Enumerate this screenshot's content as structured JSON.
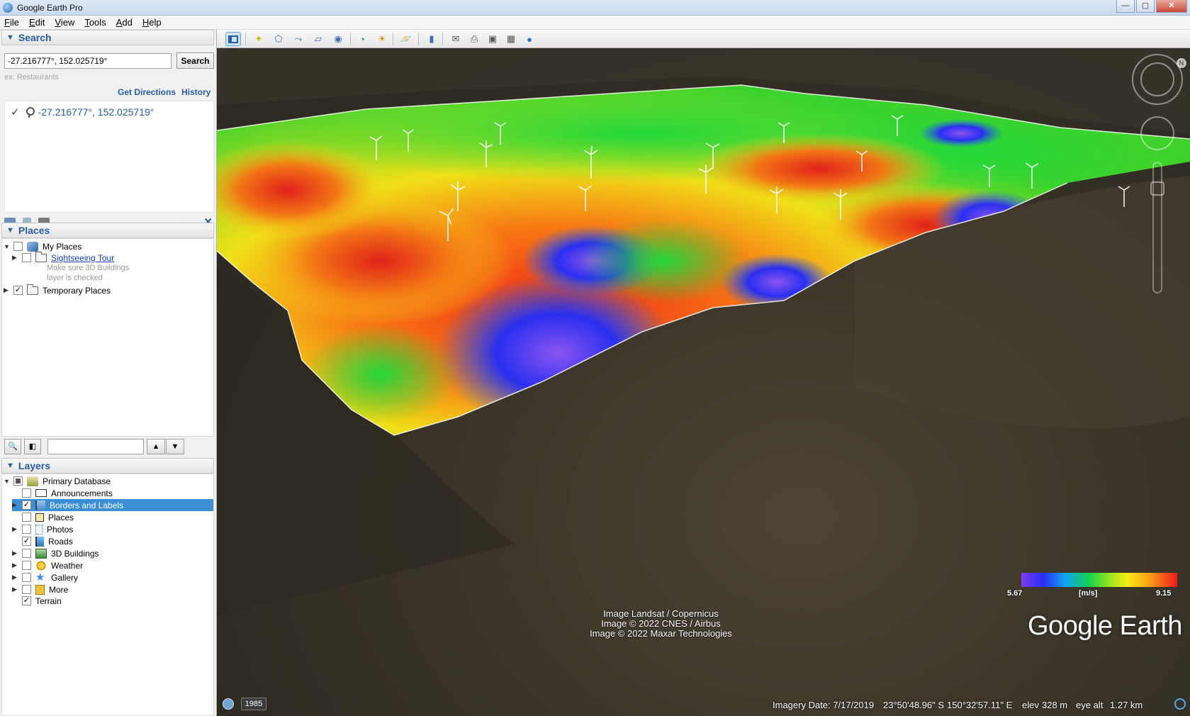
{
  "window": {
    "title": "Google Earth Pro",
    "minimize": "—",
    "maximize": "▢",
    "close": "✕"
  },
  "menu": [
    {
      "label": "File",
      "underline": "F",
      "rest": "ile"
    },
    {
      "label": "Edit",
      "underline": "E",
      "rest": "dit"
    },
    {
      "label": "View",
      "underline": "V",
      "rest": "iew"
    },
    {
      "label": "Tools",
      "underline": "T",
      "rest": "ools"
    },
    {
      "label": "Add",
      "underline": "A",
      "rest": "dd"
    },
    {
      "label": "Help",
      "underline": "H",
      "rest": "elp"
    }
  ],
  "search": {
    "header": "Search",
    "query": "-27.216777°, 152.025719°",
    "button": "Search",
    "hint": "ex: Restaurants",
    "get_directions": "Get Directions",
    "history": "History",
    "result": "-27.216777°, 152.025719°"
  },
  "places": {
    "header": "Places",
    "my_places": "My Places",
    "sightseeing_tour": "Sightseeing Tour",
    "note_line1": "Make sure 3D Buildings",
    "note_line2": "layer is checked",
    "temporary_places": "Temporary Places"
  },
  "layers": {
    "header": "Layers",
    "items": [
      {
        "label": "Primary Database",
        "checked": "partial",
        "expand": "▼"
      },
      {
        "label": "Announcements",
        "checked": "no",
        "expand": ""
      },
      {
        "label": "Borders and Labels",
        "checked": "yes",
        "expand": "▶"
      },
      {
        "label": "Places",
        "checked": "no",
        "expand": ""
      },
      {
        "label": "Photos",
        "checked": "no",
        "expand": "▶"
      },
      {
        "label": "Roads",
        "checked": "yes",
        "expand": ""
      },
      {
        "label": "3D Buildings",
        "checked": "no",
        "expand": "▶"
      },
      {
        "label": "Weather",
        "checked": "no",
        "expand": "▶"
      },
      {
        "label": "Gallery",
        "checked": "no",
        "expand": "▶"
      },
      {
        "label": "More",
        "checked": "no",
        "expand": "▶"
      },
      {
        "label": "Terrain",
        "checked": "yes",
        "expand": ""
      }
    ]
  },
  "map": {
    "attribution_1": "Image Landsat / Copernicus",
    "attribution_2": "Image © 2022 CNES / Airbus",
    "attribution_3": "Image © 2022 Maxar Technologies",
    "legend_min": "5.67",
    "legend_unit": "[m/s]",
    "legend_max": "9.15",
    "logo": "Google Earth",
    "history_year": "1985",
    "imagery_date": "Imagery Date: 7/17/2019",
    "lat": "23°50'48.96\" S",
    "lon": "150°32'57.11\" E",
    "elev_label": "elev",
    "elev": "328 m",
    "eye_alt_label": "eye alt",
    "eye_alt": "1.27 km"
  },
  "colors": {
    "accent": "#2a5d9f",
    "selection": "#3b8fd6"
  }
}
